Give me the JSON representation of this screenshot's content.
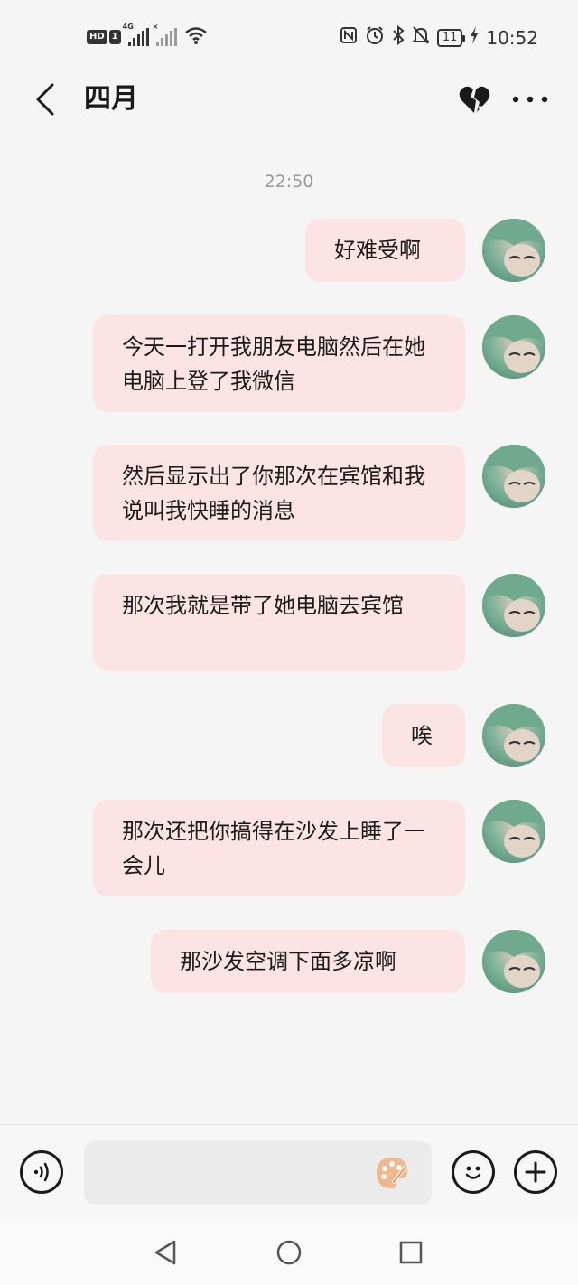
{
  "status_bar": {
    "hd_label": "HD",
    "sim_label": "1",
    "network_label": "4G",
    "battery": "11",
    "time": "10:52"
  },
  "header": {
    "title": "四月"
  },
  "chat": {
    "timestamp": "22:50",
    "messages": [
      {
        "text": "好难受啊"
      },
      {
        "text": "今天一打开我朋友电脑然后在她电脑上登了我微信"
      },
      {
        "text": "然后显示出了你那次在宾馆和我说叫我快睡的消息"
      },
      {
        "text": "那次我就是带了她电脑去宾馆"
      },
      {
        "text": "唉"
      },
      {
        "text": "那次还把你搞得在沙发上睡了一会儿"
      },
      {
        "text": "那沙发空调下面多凉啊"
      }
    ]
  },
  "colors": {
    "bubble": "#fce4e4",
    "background": "#f5f5f5",
    "timestamp": "#999999"
  },
  "icons": {
    "back": "chevron-left-icon",
    "heart": "broken-heart-icon",
    "more": "more-dots-icon",
    "voice": "voice-icon",
    "palette": "palette-icon",
    "emoji": "emoji-icon",
    "plus": "plus-icon"
  }
}
